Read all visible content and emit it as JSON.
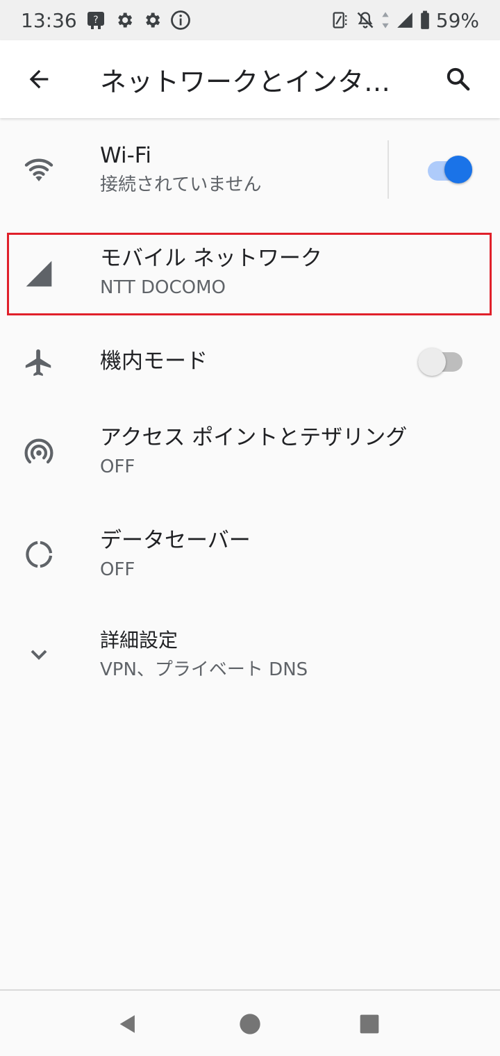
{
  "status_bar": {
    "time": "13:36",
    "battery": "59%"
  },
  "app_bar": {
    "title": "ネットワークとインタ…"
  },
  "items": [
    {
      "title": "Wi-Fi",
      "subtitle": "接続されていません"
    },
    {
      "title": "モバイル ネットワーク",
      "subtitle": "NTT DOCOMO"
    },
    {
      "title": "機内モード"
    },
    {
      "title": "アクセス ポイントとテザリング",
      "subtitle": "OFF"
    },
    {
      "title": "データセーバー",
      "subtitle": "OFF"
    },
    {
      "title": "詳細設定",
      "subtitle": "VPN、プライベート DNS"
    }
  ],
  "toggles": {
    "wifi": {
      "on": true
    },
    "airplane": {
      "on": false
    }
  },
  "colors": {
    "accent": "#1a73e8",
    "accent_track": "#aecbfa",
    "highlight": "#e0202a",
    "icon_gray": "#5f6368"
  },
  "icons": {
    "back": "arrow-back-icon",
    "search": "search-icon",
    "wifi": "wifi-icon",
    "mobile": "signal-icon",
    "airplane": "airplane-icon",
    "hotspot": "hotspot-icon",
    "data_saver": "data-saver-icon",
    "advanced": "chevron-down-icon"
  }
}
